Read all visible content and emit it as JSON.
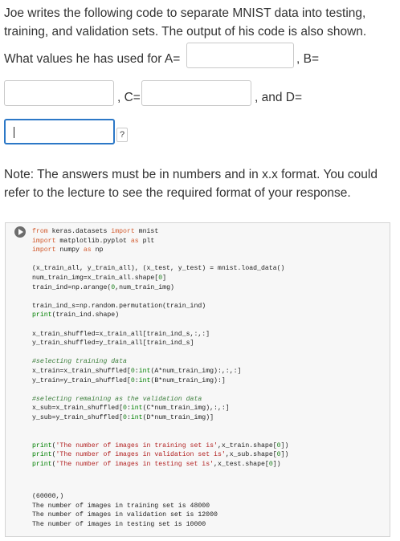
{
  "question": {
    "line1": "Joe writes the following code to separate MNIST data into testing,",
    "line2": "training, and validation sets. The output of his code is also shown.",
    "prompt_prefix": "What values he has used for A=",
    "label_b": ", B=",
    "label_c": ", C=",
    "label_d": ", and D=",
    "help": "?",
    "inputs": {
      "A": "",
      "B": "",
      "C": "",
      "D": ""
    },
    "note_line1": "Note: The answers must be in numbers and in x.x format. You could",
    "note_line2": "refer to the lecture to see the required format of your response."
  },
  "code": [
    [
      [
        "kw",
        "from"
      ],
      [
        "t",
        " keras.datasets "
      ],
      [
        "kw",
        "import"
      ],
      [
        "t",
        " mnist"
      ]
    ],
    [
      [
        "kw",
        "import"
      ],
      [
        "t",
        " matplotlib.pyplot "
      ],
      [
        "kw",
        "as"
      ],
      [
        "t",
        " plt"
      ]
    ],
    [
      [
        "kw",
        "import"
      ],
      [
        "t",
        " numpy "
      ],
      [
        "kw",
        "as"
      ],
      [
        "t",
        " np"
      ]
    ],
    [
      [
        "t",
        ""
      ]
    ],
    [
      [
        "t",
        "(x_train_all, y_train_all), (x_test, y_test) = mnist.load_data()"
      ]
    ],
    [
      [
        "t",
        "num_train_img=x_train_all.shape["
      ],
      [
        "num",
        "0"
      ],
      [
        "t",
        "]"
      ]
    ],
    [
      [
        "t",
        "train_ind=np.arange("
      ],
      [
        "num",
        "0"
      ],
      [
        "t",
        ",num_train_img)"
      ]
    ],
    [
      [
        "t",
        ""
      ]
    ],
    [
      [
        "t",
        "train_ind_s=np.random.permutation(train_ind)"
      ]
    ],
    [
      [
        "nm",
        "print"
      ],
      [
        "t",
        "(train_ind.shape)"
      ]
    ],
    [
      [
        "t",
        ""
      ]
    ],
    [
      [
        "t",
        "x_train_shuffled=x_train_all[train_ind_s,:,:]"
      ]
    ],
    [
      [
        "t",
        "y_train_shuffled=y_train_all[train_ind_s]"
      ]
    ],
    [
      [
        "t",
        ""
      ]
    ],
    [
      [
        "cm",
        "#selecting training data"
      ]
    ],
    [
      [
        "t",
        "x_train=x_train_shuffled["
      ],
      [
        "num",
        "0"
      ],
      [
        "t",
        ":"
      ],
      [
        "nm",
        "int"
      ],
      [
        "t",
        "(A*num_train_img):,:,:]"
      ]
    ],
    [
      [
        "t",
        "y_train=y_train_shuffled["
      ],
      [
        "num",
        "0"
      ],
      [
        "t",
        ":"
      ],
      [
        "nm",
        "int"
      ],
      [
        "t",
        "(B*num_train_img):]"
      ]
    ],
    [
      [
        "t",
        ""
      ]
    ],
    [
      [
        "cm",
        "#selecting remaining as the validation data"
      ]
    ],
    [
      [
        "t",
        "x_sub=x_train_shuffled["
      ],
      [
        "num",
        "0"
      ],
      [
        "t",
        ":"
      ],
      [
        "nm",
        "int"
      ],
      [
        "t",
        "(C*num_train_img),:,:]"
      ]
    ],
    [
      [
        "t",
        "y_sub=y_train_shuffled["
      ],
      [
        "num",
        "0"
      ],
      [
        "t",
        ":"
      ],
      [
        "nm",
        "int"
      ],
      [
        "t",
        "(D*num_train_img)]"
      ]
    ],
    [
      [
        "t",
        ""
      ]
    ],
    [
      [
        "t",
        ""
      ]
    ],
    [
      [
        "nm",
        "print"
      ],
      [
        "t",
        "("
      ],
      [
        "str",
        "'The number of images in training set is'"
      ],
      [
        "t",
        ",x_train.shape["
      ],
      [
        "num",
        "0"
      ],
      [
        "t",
        "])"
      ]
    ],
    [
      [
        "nm",
        "print"
      ],
      [
        "t",
        "("
      ],
      [
        "str",
        "'The number of images in validation set is'"
      ],
      [
        "t",
        ",x_sub.shape["
      ],
      [
        "num",
        "0"
      ],
      [
        "t",
        "])"
      ]
    ],
    [
      [
        "nm",
        "print"
      ],
      [
        "t",
        "("
      ],
      [
        "str",
        "'The number of images in testing set is'"
      ],
      [
        "t",
        ",x_test.shape["
      ],
      [
        "num",
        "0"
      ],
      [
        "t",
        "])"
      ]
    ]
  ],
  "output": [
    "(60000,)",
    "The number of images in training set is 48000",
    "The number of images in validation set is 12000",
    "The number of images in testing set is 10000"
  ]
}
